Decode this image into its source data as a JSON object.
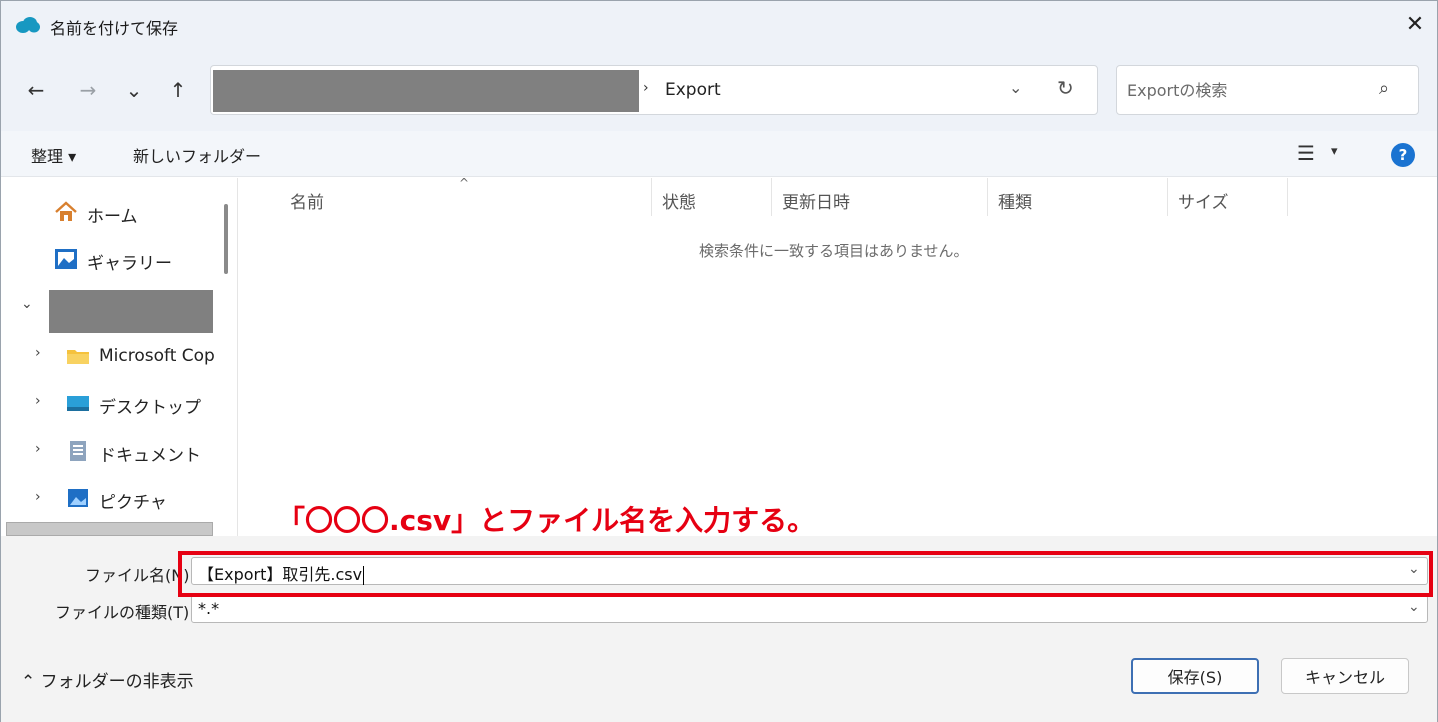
{
  "window": {
    "title": "名前を付けて保存",
    "close_label": "✕"
  },
  "nav": {
    "back": "←",
    "forward": "→",
    "recent": "⌄",
    "up": "↑",
    "address_separator": "›",
    "address_folder": "Export",
    "address_dropdown": "⌄",
    "refresh": "↻",
    "search_placeholder": "Exportの検索",
    "search_icon": "⌕"
  },
  "toolbar": {
    "organize_label": "整理 ▾",
    "new_folder_label": "新しいフォルダー",
    "view_icon": "☰",
    "view_dropdown": "▾",
    "help_label": "?"
  },
  "sidebar": {
    "items": [
      {
        "label": "ホーム",
        "icon": "home-icon"
      },
      {
        "label": "ギャラリー",
        "icon": "gallery-icon"
      },
      {
        "label": "Microsoft Cop",
        "icon": "folder-icon"
      },
      {
        "label": "デスクトップ",
        "icon": "desktop-icon"
      },
      {
        "label": "ドキュメント",
        "icon": "document-icon"
      },
      {
        "label": "ピクチャ",
        "icon": "pictures-icon"
      }
    ],
    "expand_open": "⌄",
    "expand_closed": "›"
  },
  "list": {
    "columns": [
      "名前",
      "状態",
      "更新日時",
      "種類",
      "サイズ"
    ],
    "sort_caret": "^",
    "empty_message": "検索条件に一致する項目はありません。"
  },
  "annotation": "「〇〇〇.csv」とファイル名を入力する。",
  "bottom": {
    "filename_label": "ファイル名(N):",
    "filename_value": "【Export】取引先.csv",
    "filetype_label": "ファイルの種類(T):",
    "filetype_value": "*.*",
    "dropdown": "⌄",
    "folder_toggle": "⌃  フォルダーの非表示",
    "save_button": "保存(S)",
    "cancel_button": "キャンセル"
  },
  "colors": {
    "annotation": "#e60012",
    "accent": "#1a73d1",
    "primary_border": "#3d6fb3"
  }
}
